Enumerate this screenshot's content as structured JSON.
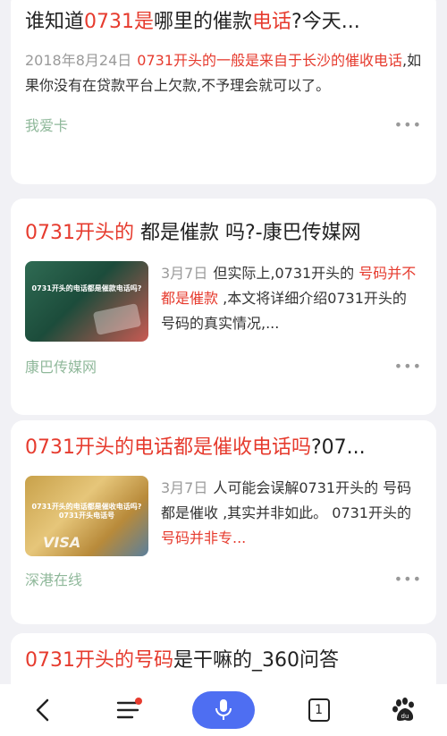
{
  "results": [
    {
      "title_parts": [
        "谁知道",
        "0731是",
        "哪里的催款",
        "电话",
        "?今天..."
      ],
      "date": "2018年8月24日",
      "desc_parts": [
        "0731开头的一般是来自于长沙的催收电话",
        ",如果你没有在贷款平台上欠款,不予理会就可以了。"
      ],
      "source": "我爱卡",
      "more": "•••"
    },
    {
      "title_parts": [
        "0731开头的",
        " 都是催款 吗?-康巴传媒网"
      ],
      "date": "3月7日",
      "desc_parts": [
        "但实际上,0731开头的 ",
        "号码并不都是催款",
        " ,本文将详细介绍0731开头的 号码的真实情况,..."
      ],
      "thumb_caption": "0731开头的电话都是催款电话吗?",
      "source": "康巴传媒网",
      "more": "•••"
    },
    {
      "title_parts": [
        "0731开头的电话都是催收电话吗",
        "?07..."
      ],
      "date": "3月7日",
      "desc_parts": [
        "人可能会误解0731开头的 号码都是催收 ,其实并非如此。 0731开头的 ",
        "号码并非专..."
      ],
      "thumb_caption": "0731开头的电话都是催收电话吗? 0731开头电话号",
      "thumb_brand": "VISA",
      "source": "深港在线",
      "more": "•••"
    },
    {
      "title_parts": [
        "0731开头的号码",
        "是干嘛的_360问答"
      ]
    }
  ],
  "bottom_nav": {
    "back_icon": "chevron-left-icon",
    "menu_icon": "menu-icon",
    "voice_icon": "microphone-icon",
    "tab_count": "1",
    "home_icon": "baidu-paw-icon"
  }
}
